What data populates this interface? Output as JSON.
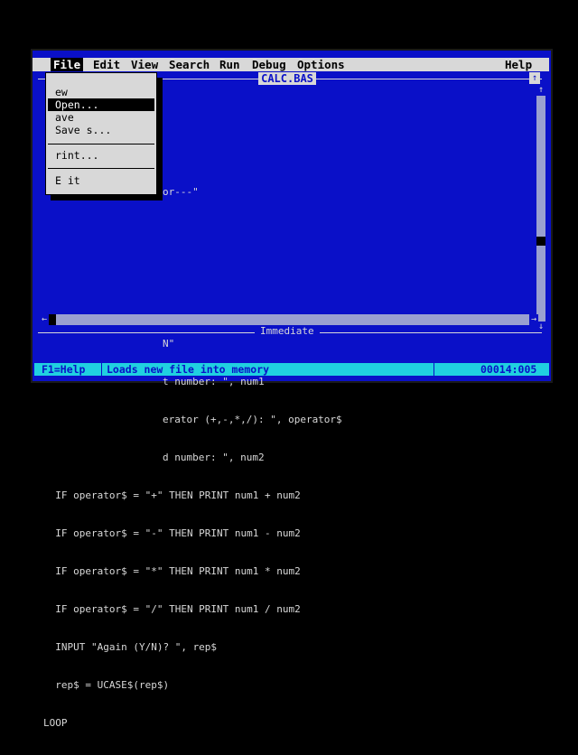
{
  "menubar": {
    "items": [
      "File",
      "Edit",
      "View",
      "Search",
      "Run",
      "Debug",
      "Options"
    ],
    "help": "Help"
  },
  "editor": {
    "filename": "CALC.BAS",
    "max_button": "↑",
    "lines": [
      "",
      "",
      "or---\"",
      "",
      "",
      "",
      "N\"",
      "t number: \", num1",
      "erator (+,-,*,/): \", operator$",
      "d number: \", num2",
      "  IF operator$ = \"+\" THEN PRINT num1 + num2",
      "  IF operator$ = \"-\" THEN PRINT num1 - num2",
      "  IF operator$ = \"*\" THEN PRINT num1 * num2",
      "  IF operator$ = \"/\" THEN PRINT num1 / num2",
      "  INPUT \"Again (Y/N)? \", rep$",
      "  rep$ = UCASE$(rep$)",
      "LOOP"
    ]
  },
  "file_menu": {
    "items": [
      "ew",
      "Open...",
      "ave",
      "Save  s...",
      "rint...",
      "E it"
    ],
    "selected_index": 1
  },
  "scrollbars": {
    "up_arrow": "↑",
    "down_arrow": "↓",
    "left_arrow": "←",
    "right_arrow": "→"
  },
  "immediate": {
    "label": "Immediate"
  },
  "statusbar": {
    "key_hint": "F1=Help",
    "message": "Loads new file into memory",
    "position": "00014:005"
  },
  "colors": {
    "background": "#0a10c8",
    "menu": "#d8d8d8",
    "status": "#20d0e0",
    "text": "#d8d8d8"
  }
}
